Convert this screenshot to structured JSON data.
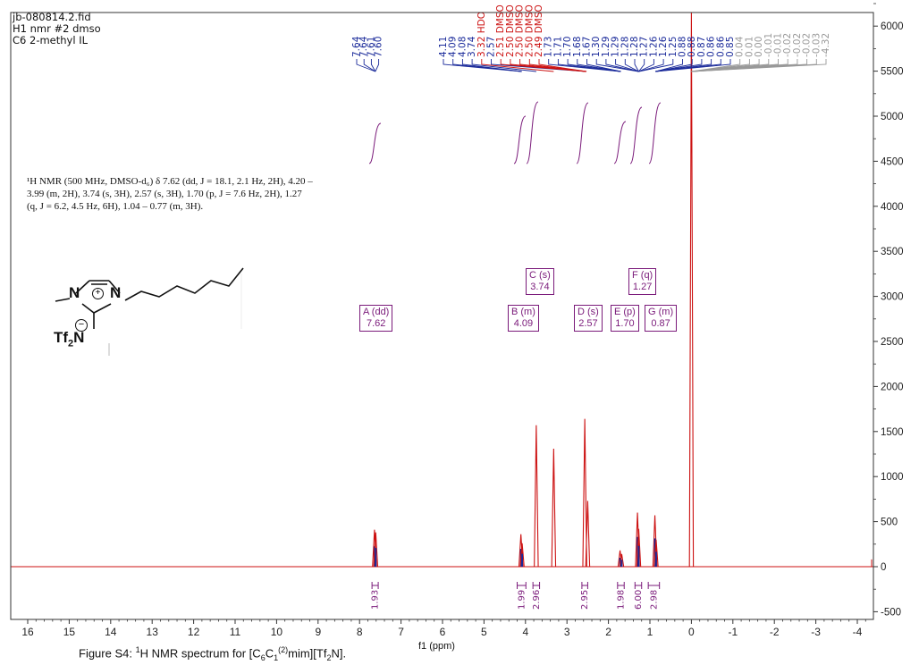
{
  "header": {
    "line1": "jb-080814.2.fid",
    "line2": "H1 nmr  #2 dmso",
    "line3": "C6 2-methyl IL"
  },
  "summary_text": "¹H NMR (500 MHz, DMSO-d₆) δ 7.62 (dd, J = 18.1, 2.1 Hz, 2H), 4.20 – 3.99 (m, 2H), 3.74 (s, 3H), 2.57 (s, 3H), 1.70 (p, J = 7.6 Hz, 2H), 1.27 (q, J = 6.2, 4.5 Hz, 6H), 1.04 – 0.77 (m, 3H).",
  "caption": {
    "prefix": "Figure S4: ",
    "sup1": "1",
    "mid": "H NMR spectrum for [C",
    "sub6": "6",
    "c": "C",
    "sub1": "1",
    "sup2": "(2)",
    "suffix": "mim][Tf",
    "sub2": "2",
    "end": "N]."
  },
  "structure": {
    "n_left": "N",
    "n_right": "N",
    "plus": "+",
    "tf2n": "Tf2N",
    "minus": "−"
  },
  "multiplet_boxes": [
    {
      "id": "A",
      "line1": "A (dd)",
      "line2": "7.62"
    },
    {
      "id": "B",
      "line1": "B (m)",
      "line2": "4.09"
    },
    {
      "id": "C",
      "line1": "C (s)",
      "line2": "3.74"
    },
    {
      "id": "D",
      "line1": "D (s)",
      "line2": "2.57"
    },
    {
      "id": "E",
      "line1": "E (p)",
      "line2": "1.70"
    },
    {
      "id": "F",
      "line1": "F (q)",
      "line2": "1.27"
    },
    {
      "id": "G",
      "line1": "G (m)",
      "line2": "0.87"
    }
  ],
  "chart_data": {
    "type": "line",
    "xlabel": "f1 (ppm)",
    "xlim": [
      16.5,
      -4.3
    ],
    "ylim": [
      -550,
      6150
    ],
    "x_ticks": [
      16,
      15,
      14,
      13,
      12,
      11,
      10,
      9,
      8,
      7,
      6,
      5,
      4,
      3,
      2,
      1,
      0,
      -1,
      -2,
      -3,
      -4
    ],
    "y_ticks": [
      -500,
      0,
      500,
      1000,
      1500,
      2000,
      2500,
      3000,
      3500,
      4000,
      4500,
      5000,
      5500,
      6000
    ],
    "peaks": [
      {
        "ppm": 7.64,
        "height": 410,
        "series": "blue"
      },
      {
        "ppm": 7.61,
        "height": 380,
        "series": "blue"
      },
      {
        "ppm": 4.11,
        "height": 360,
        "series": "blue"
      },
      {
        "ppm": 4.08,
        "height": 260,
        "series": "blue"
      },
      {
        "ppm": 3.74,
        "height": 1570,
        "series": "red"
      },
      {
        "ppm": 3.32,
        "height": 1310,
        "series": "red"
      },
      {
        "ppm": 2.57,
        "height": 1640,
        "series": "red"
      },
      {
        "ppm": 2.5,
        "height": 730,
        "series": "red"
      },
      {
        "ppm": 1.72,
        "height": 180,
        "series": "blue"
      },
      {
        "ppm": 1.68,
        "height": 140,
        "series": "blue"
      },
      {
        "ppm": 1.3,
        "height": 600,
        "series": "blue"
      },
      {
        "ppm": 1.27,
        "height": 420,
        "series": "blue"
      },
      {
        "ppm": 0.88,
        "height": 570,
        "series": "blue"
      },
      {
        "ppm": 0.85,
        "height": 300,
        "series": "blue"
      },
      {
        "ppm": 0.0,
        "height": 6150,
        "series": "red"
      }
    ],
    "peak_labels": [
      {
        "text": "7.64",
        "color": "blue"
      },
      {
        "text": "7.64",
        "color": "blue"
      },
      {
        "text": "7.61",
        "color": "blue"
      },
      {
        "text": "7.60",
        "color": "blue"
      },
      {
        "text": "4.11",
        "color": "blue"
      },
      {
        "text": "4.09",
        "color": "blue"
      },
      {
        "text": "4.08",
        "color": "blue"
      },
      {
        "text": "3.74",
        "color": "blue"
      },
      {
        "text": "3.32 HDO",
        "color": "red"
      },
      {
        "text": "2.57",
        "color": "blue"
      },
      {
        "text": "2.51 DMSO",
        "color": "red"
      },
      {
        "text": "2.50 DMSO",
        "color": "red"
      },
      {
        "text": "2.50 DMSO",
        "color": "red"
      },
      {
        "text": "2.50 DMSO",
        "color": "red"
      },
      {
        "text": "2.49 DMSO",
        "color": "red"
      },
      {
        "text": "1.73",
        "color": "blue"
      },
      {
        "text": "1.71",
        "color": "blue"
      },
      {
        "text": "1.70",
        "color": "blue"
      },
      {
        "text": "1.68",
        "color": "blue"
      },
      {
        "text": "1.67",
        "color": "blue"
      },
      {
        "text": "1.30",
        "color": "blue"
      },
      {
        "text": "1.29",
        "color": "blue"
      },
      {
        "text": "1.29",
        "color": "blue"
      },
      {
        "text": "1.28",
        "color": "blue"
      },
      {
        "text": "1.28",
        "color": "blue"
      },
      {
        "text": "1.27",
        "color": "blue"
      },
      {
        "text": "1.26",
        "color": "blue"
      },
      {
        "text": "1.26",
        "color": "blue"
      },
      {
        "text": "1.25",
        "color": "blue"
      },
      {
        "text": "0.88",
        "color": "blue"
      },
      {
        "text": "0.88",
        "color": "blue"
      },
      {
        "text": "0.87",
        "color": "blue"
      },
      {
        "text": "0.86",
        "color": "blue"
      },
      {
        "text": "0.86",
        "color": "blue"
      },
      {
        "text": "0.85",
        "color": "blue"
      },
      {
        "text": "0.04",
        "color": "gray"
      },
      {
        "text": "0.01",
        "color": "gray"
      },
      {
        "text": "0.00",
        "color": "gray"
      },
      {
        "text": "-0.01",
        "color": "gray"
      },
      {
        "text": "-0.01",
        "color": "gray"
      },
      {
        "text": "-0.02",
        "color": "gray"
      },
      {
        "text": "-0.02",
        "color": "gray"
      },
      {
        "text": "-0.02",
        "color": "gray"
      },
      {
        "text": "-0.03",
        "color": "gray"
      },
      {
        "text": "-4.32",
        "color": "gray"
      }
    ],
    "integrations": [
      {
        "ppm_from": 7.7,
        "ppm_to": 7.55,
        "value": "1.93"
      },
      {
        "ppm_from": 4.2,
        "ppm_to": 3.99,
        "value": "1.99"
      },
      {
        "ppm_from": 3.82,
        "ppm_to": 3.66,
        "value": "2.96"
      },
      {
        "ppm_from": 2.64,
        "ppm_to": 2.5,
        "value": "2.95"
      },
      {
        "ppm_from": 1.78,
        "ppm_to": 1.62,
        "value": "1.98"
      },
      {
        "ppm_from": 1.36,
        "ppm_to": 1.2,
        "value": "6.00"
      },
      {
        "ppm_from": 1.04,
        "ppm_to": 0.77,
        "value": "2.98"
      }
    ],
    "colors": {
      "red": "#cc1111",
      "blue": "#1a2a9a",
      "gray": "#999999",
      "integral": "#7a1a7a"
    }
  }
}
